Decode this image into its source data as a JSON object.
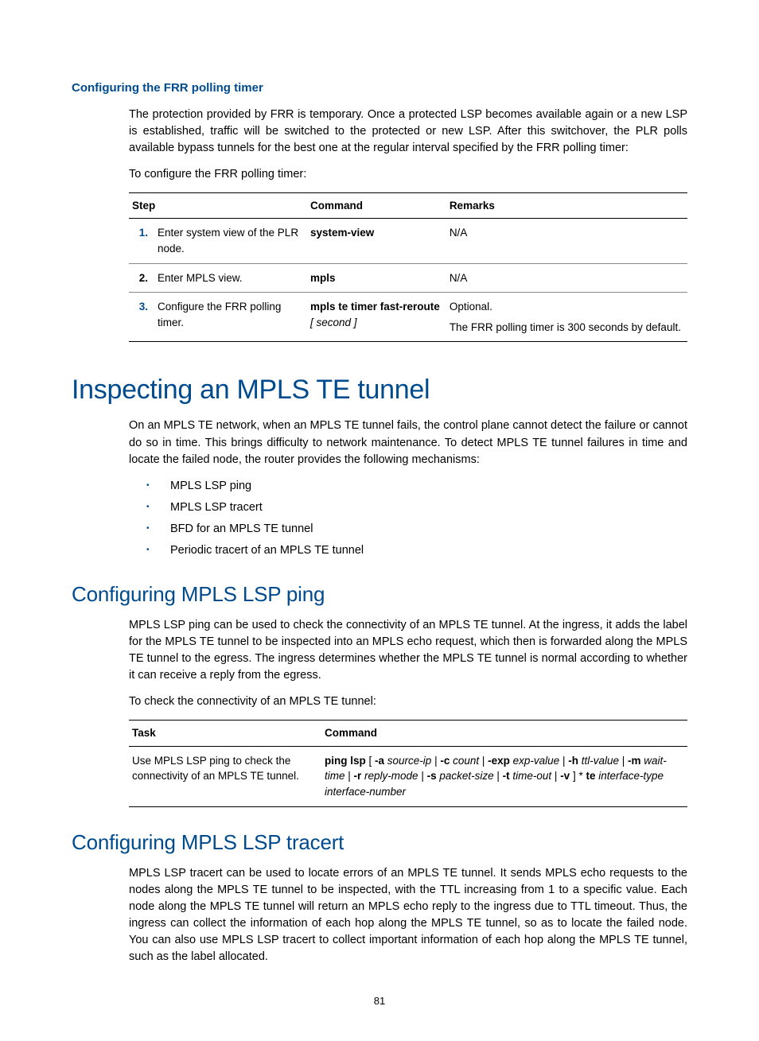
{
  "section1": {
    "heading": "Configuring the FRR polling timer",
    "p1": "The protection provided by FRR is temporary. Once a protected LSP becomes available again or a new LSP is established, traffic will be switched to the protected or new LSP. After this switchover, the PLR polls available bypass tunnels for the best one at the regular interval specified by the FRR polling timer:",
    "p2": "To configure the FRR polling timer:",
    "table": {
      "headers": [
        "Step",
        "Command",
        "Remarks"
      ],
      "rows": [
        {
          "num": "1.",
          "step": "Enter system view of the PLR node.",
          "cmd_bold": "system-view",
          "cmd_italic": "",
          "remarks": "N/A",
          "remarks2": ""
        },
        {
          "num": "2.",
          "step": "Enter MPLS view.",
          "cmd_bold": "mpls",
          "cmd_italic": "",
          "remarks": "N/A",
          "remarks2": ""
        },
        {
          "num": "3.",
          "step": "Configure the FRR polling timer.",
          "cmd_bold": "mpls te timer fast-reroute",
          "cmd_italic": "[ second ]",
          "remarks": "Optional.",
          "remarks2": "The FRR polling timer is 300 seconds by default."
        }
      ]
    }
  },
  "section2": {
    "heading": "Inspecting an MPLS TE tunnel",
    "p1": "On an MPLS TE network, when an MPLS TE tunnel fails, the control plane cannot detect the failure or cannot do so in time. This brings difficulty to network maintenance. To detect MPLS TE tunnel failures in time and locate the failed node, the router provides the following mechanisms:",
    "bullets": [
      "MPLS LSP ping",
      "MPLS LSP tracert",
      "BFD for an MPLS TE tunnel",
      "Periodic tracert of an MPLS TE tunnel"
    ]
  },
  "section3": {
    "heading": "Configuring MPLS LSP ping",
    "p1": "MPLS LSP ping can be used to check the connectivity of an MPLS TE tunnel. At the ingress, it adds the label for the MPLS TE tunnel to be inspected into an MPLS echo request, which then is forwarded along the MPLS TE tunnel to the egress. The ingress determines whether the MPLS TE tunnel is normal according to whether it can receive a reply from the egress.",
    "p2": "To check the connectivity of an MPLS TE tunnel:",
    "table": {
      "headers": [
        "Task",
        "Command"
      ],
      "task": "Use MPLS LSP ping to check the connectivity of an MPLS TE tunnel.",
      "cmd": {
        "b1": "ping lsp",
        "t1": " [ ",
        "b2": "-a",
        "i1": " source-ip",
        "t2": " | ",
        "b3": "-c",
        "i2": " count",
        "t3": " | ",
        "b4": "-exp",
        "i3": " exp-value",
        "t4": " | ",
        "b5": "-h",
        "i4": " ttl-value",
        "t5": " | ",
        "b6": "-m",
        "i5": " wait-time",
        "t6": " | ",
        "b7": "-r",
        "i6": " reply-mode",
        "t7": " | ",
        "b8": "-s",
        "i7": " packet-size",
        "t8": " | ",
        "b9": "-t",
        "i8": " time-out",
        "t9": " | ",
        "b10": "-v",
        "t10": " ] * ",
        "b11": "te",
        "i9": " interface-type interface-number"
      }
    }
  },
  "section4": {
    "heading": "Configuring MPLS LSP tracert",
    "p1": "MPLS LSP tracert can be used to locate errors of an MPLS TE tunnel. It sends MPLS echo requests to the nodes along the MPLS TE tunnel to be inspected, with the TTL increasing from 1 to a specific value. Each node along the MPLS TE tunnel will return an MPLS echo reply to the ingress due to TTL timeout. Thus, the ingress can collect the information of each hop along the MPLS TE tunnel, so as to locate the failed node. You can also use MPLS LSP tracert to collect important information of each hop along the MPLS TE tunnel, such as the label allocated."
  },
  "pageNumber": "81"
}
